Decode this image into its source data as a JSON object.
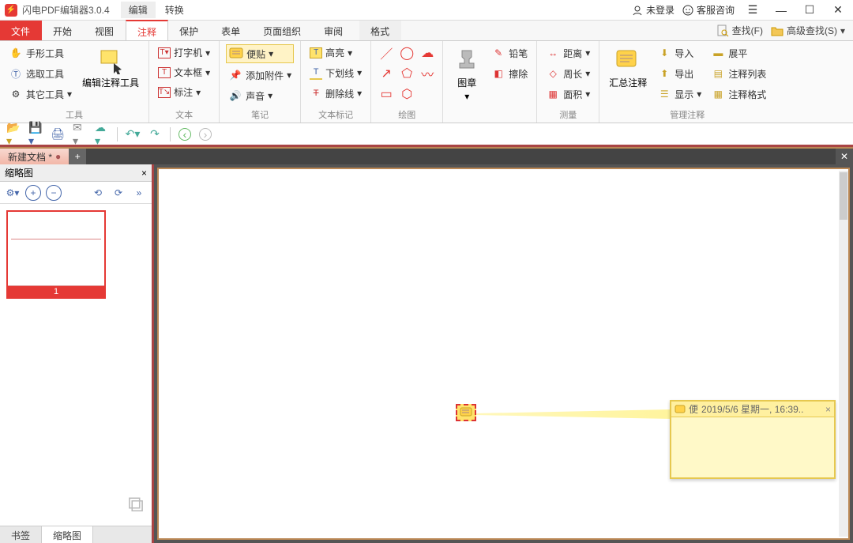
{
  "app": {
    "title": "闪电PDF编辑器3.0.4",
    "mode_tabs": [
      "编辑",
      "转换"
    ],
    "mode_active": 0
  },
  "titlebar_right": {
    "login": "未登录",
    "support": "客服咨询"
  },
  "menu_tabs": {
    "file": "文件",
    "items": [
      "开始",
      "视图",
      "注释",
      "保护",
      "表单",
      "页面组织",
      "审阅"
    ],
    "active_index": 2,
    "format": "格式"
  },
  "search": {
    "find": "查找(F)",
    "adv_find": "高级查找(S)"
  },
  "ribbon": {
    "tools": {
      "label": "工具",
      "hand": "手形工具",
      "select": "选取工具",
      "other": "其它工具",
      "edit_annots": "编辑注释工具"
    },
    "text": {
      "label": "文本",
      "typewriter": "打字机",
      "textbox": "文本框",
      "callout": "标注"
    },
    "notes": {
      "label": "笔记",
      "sticky": "便贴",
      "attach": "添加附件",
      "sound": "声音"
    },
    "textmark": {
      "label": "文本标记",
      "highlight": "高亮",
      "underline": "下划线",
      "strike": "删除线"
    },
    "draw": {
      "label": "绘图",
      "stamp": "图章",
      "pencil": "铅笔",
      "erase": "擦除"
    },
    "measure": {
      "label": "测量",
      "distance": "距离",
      "perimeter": "周长",
      "area": "面积"
    },
    "manage": {
      "label": "管理注释",
      "summary": "汇总注释",
      "import": "导入",
      "export": "导出",
      "show": "显示",
      "flatten": "展平",
      "list": "注释列表",
      "format": "注释格式"
    }
  },
  "doc_tab": {
    "name": "新建文档 *"
  },
  "sidebar": {
    "title": "缩略图",
    "page_number": "1",
    "bottom_tabs": [
      "书签",
      "缩略图"
    ],
    "bottom_active": 1
  },
  "sticky_popup": {
    "author": "便",
    "date": "2019/5/6 星期一, 16:39.."
  }
}
